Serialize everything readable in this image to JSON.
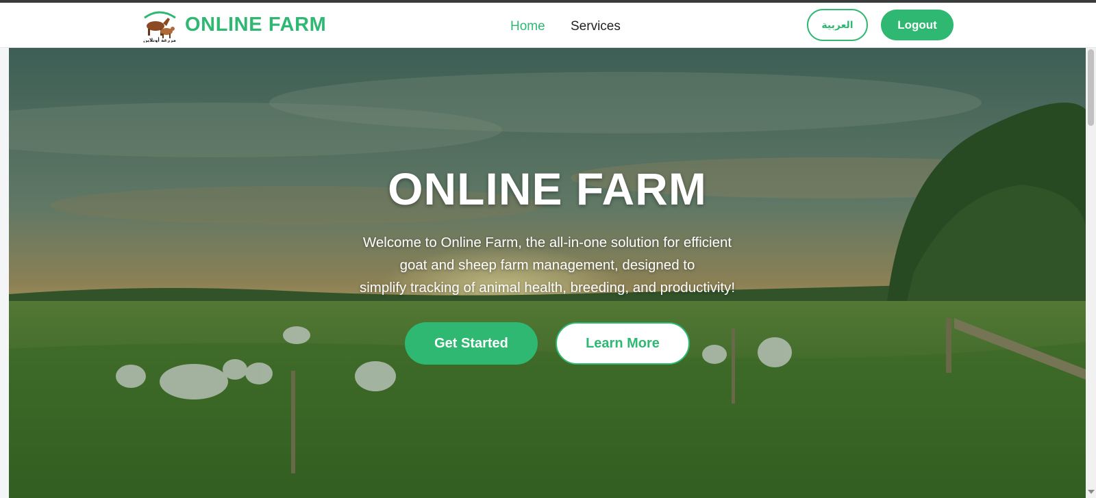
{
  "header": {
    "brand": "ONLINE FARM",
    "logo_caption": "مزرعة أونلاين",
    "nav": {
      "home": "Home",
      "services": "Services"
    },
    "language_button": "العربية",
    "logout_button": "Logout"
  },
  "hero": {
    "title": "ONLINE FARM",
    "text_lines": [
      "Welcome to Online Farm, the all-in-one solution for efficient",
      "goat and sheep farm management, designed to",
      "simplify tracking of animal health, breeding, and productivity!"
    ],
    "primary_button": "Get Started",
    "secondary_button": "Learn More"
  },
  "colors": {
    "accent": "#2eb872",
    "nav_text": "#1f1f1f",
    "hero_text": "#ffffff"
  },
  "icons": [
    "farm-logo-icon",
    "scroll-down-arrow-icon"
  ]
}
